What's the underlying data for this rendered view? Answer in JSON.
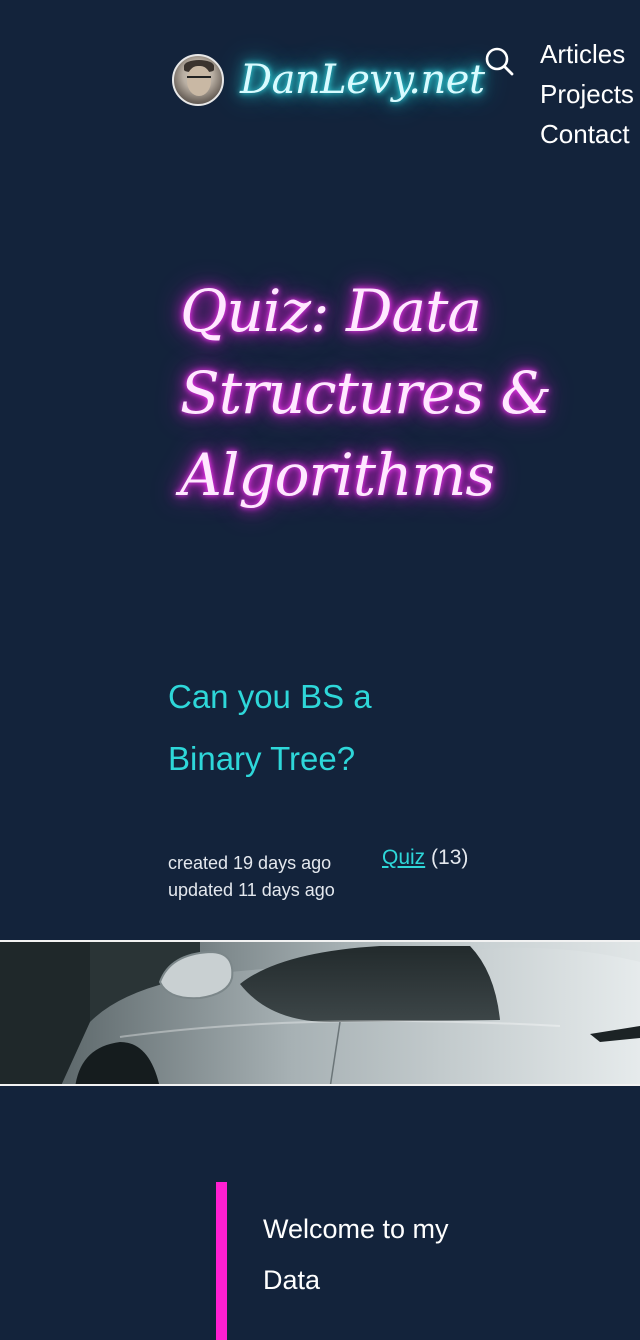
{
  "header": {
    "brand_name": "DanLevy.net",
    "avatar_icon": "avatar-photo",
    "search_icon": "search-icon",
    "nav": [
      {
        "label": "Articles"
      },
      {
        "label": "Projects"
      },
      {
        "label": "Contact"
      }
    ]
  },
  "post": {
    "title": "Quiz: Data Structures & Algorithms",
    "subtitle": "Can you BS a Binary Tree?",
    "created": "created 19 days ago",
    "updated": "updated 11 days ago",
    "tag_label": "Quiz",
    "tag_count": "(13)",
    "hero_image": "silver sports car in rain"
  },
  "intro": {
    "text": "Welcome to my Data"
  },
  "colors": {
    "background": "#13233b",
    "brand_glow": "#2bd2dc",
    "title_glow": "#e81fe0",
    "accent_cyan": "#2ed7d9",
    "accent_pink": "#ff1fd0"
  }
}
